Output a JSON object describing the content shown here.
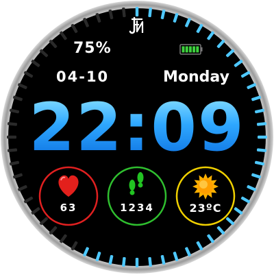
{
  "status": {
    "battery_percent": "75%",
    "battery_level": 1.0
  },
  "date": {
    "date": "04-10",
    "weekday": "Monday"
  },
  "clock": {
    "time": "22:09"
  },
  "widgets": {
    "heart_rate": {
      "value": "63",
      "icon": "heart-icon",
      "ring_color": "#e02020"
    },
    "steps": {
      "value": "1234",
      "icon": "footprints-icon",
      "ring_color": "#2fbf2f"
    },
    "weather": {
      "value": "23ºC",
      "icon": "sun-icon",
      "ring_color": "#f0d000"
    }
  },
  "colors": {
    "accent": "#4ec8ff",
    "background": "#000000",
    "bezel": "#c9c9c9"
  }
}
